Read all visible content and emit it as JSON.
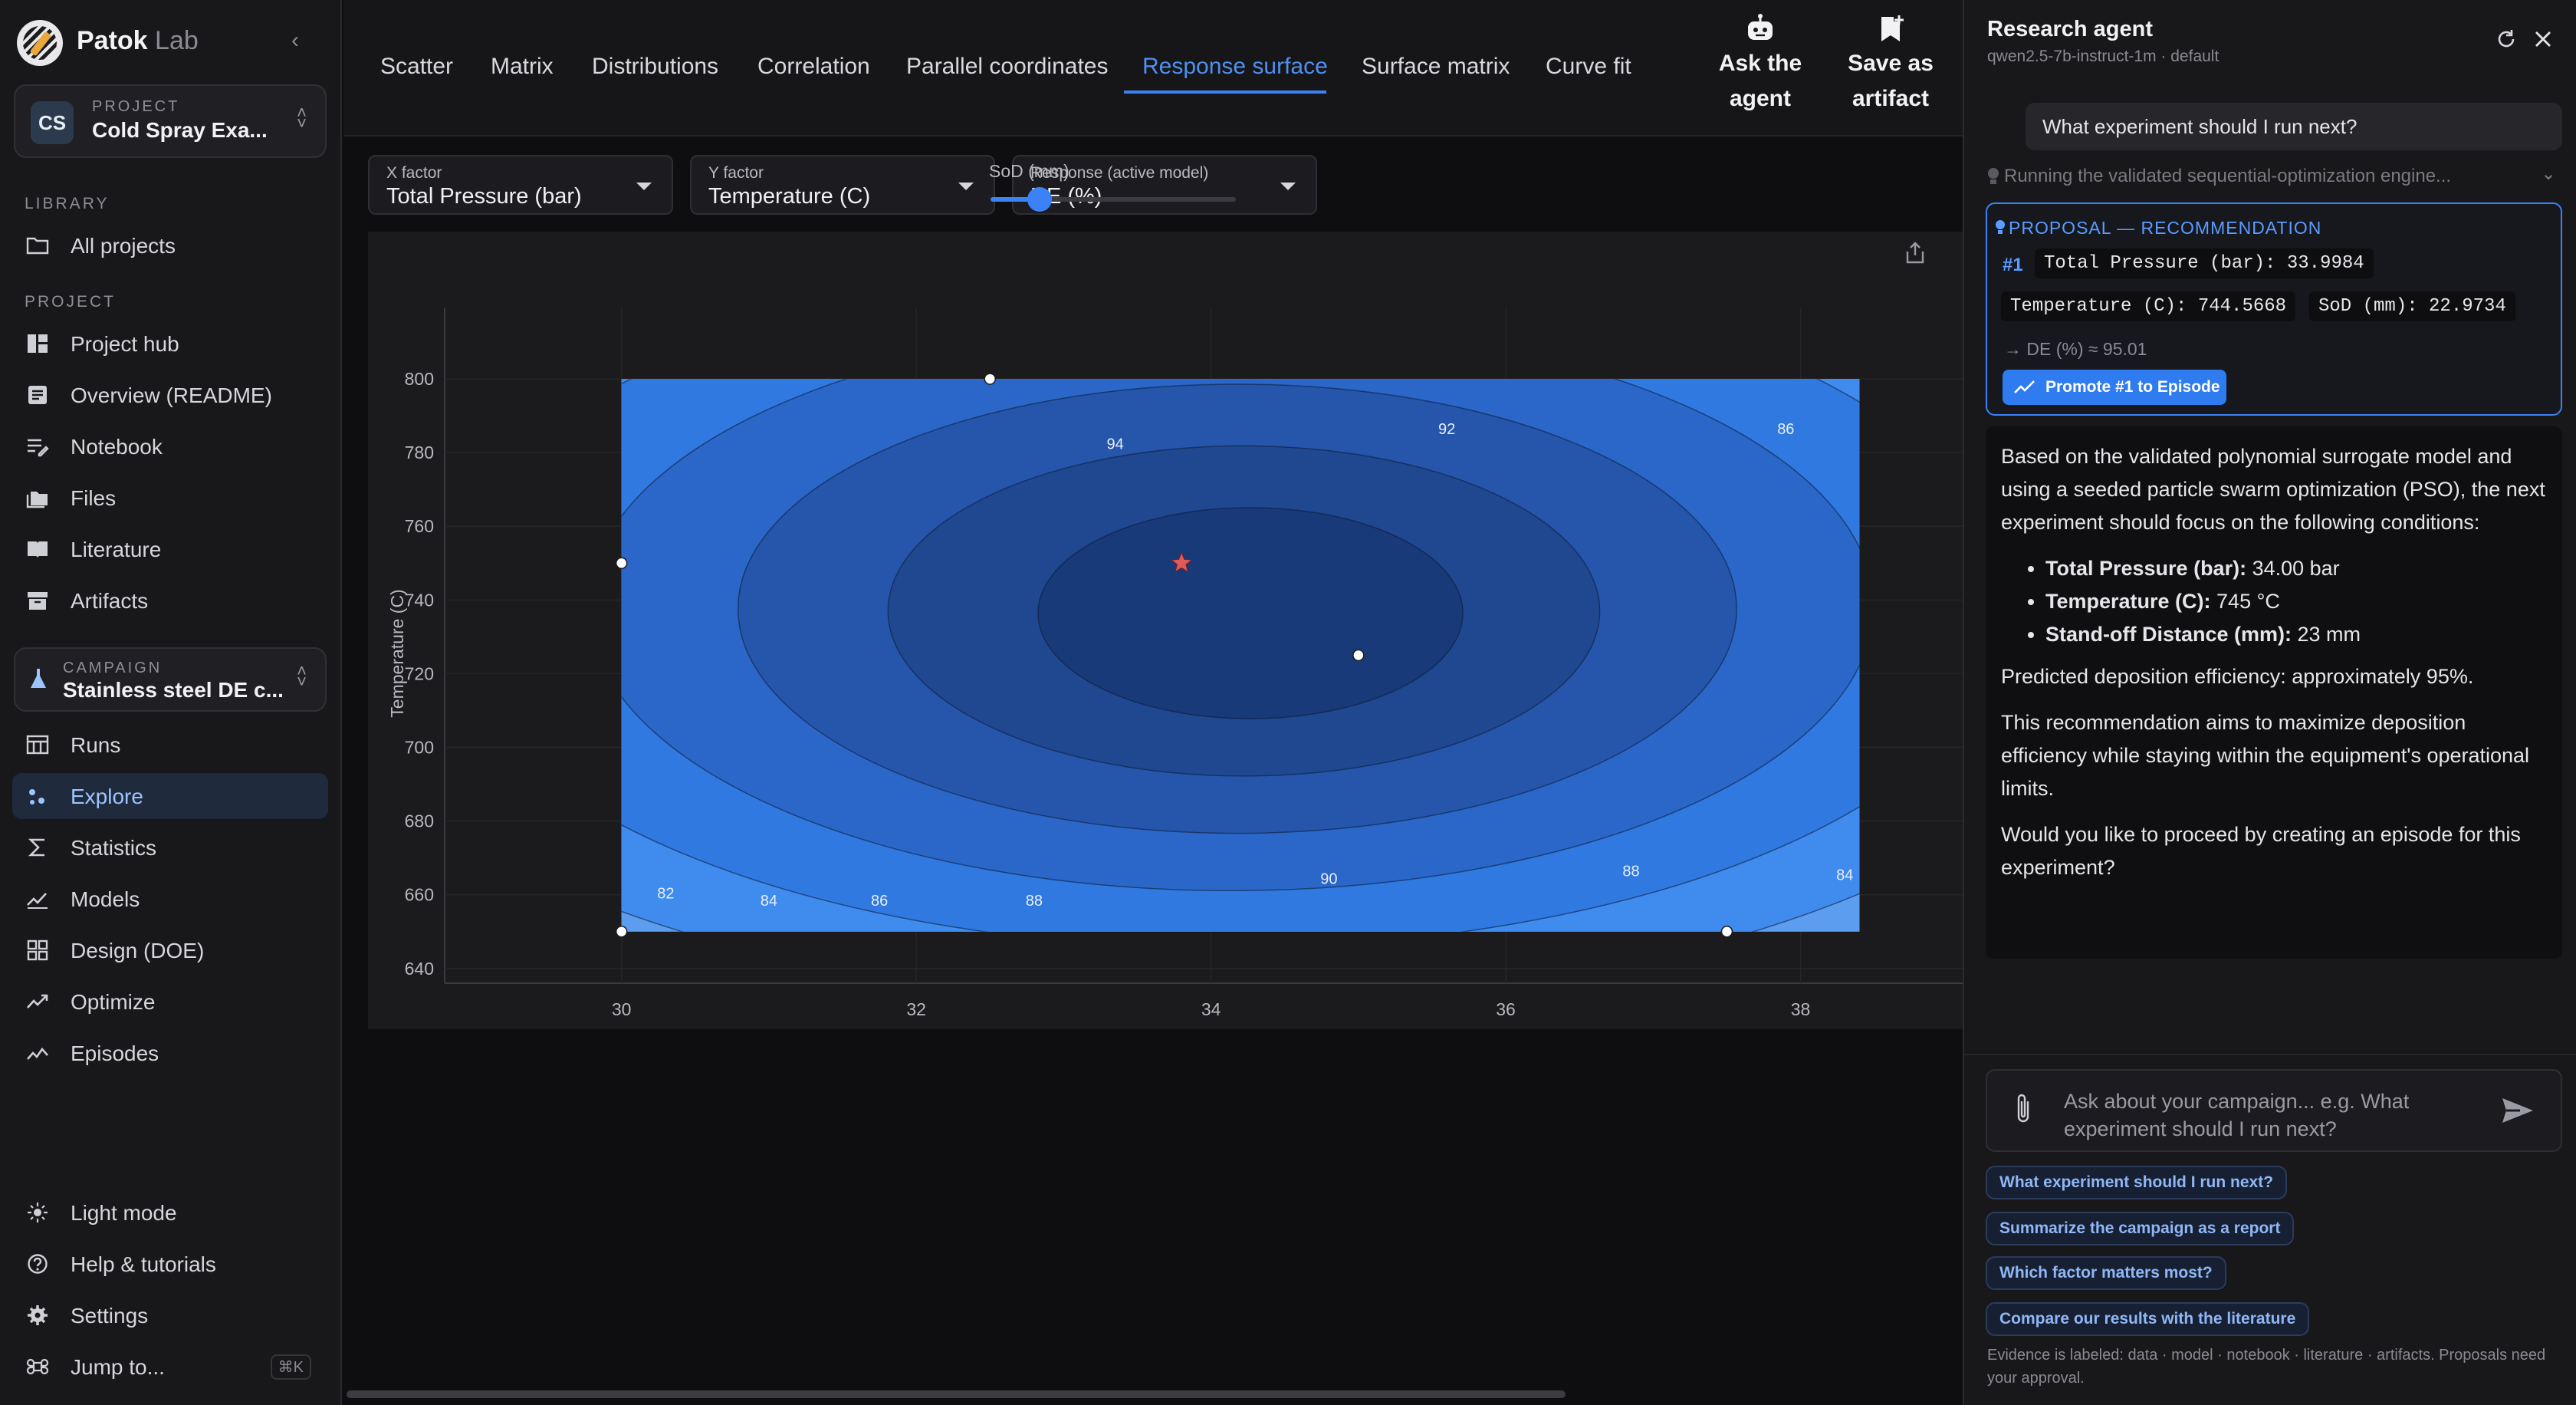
{
  "app": {
    "brand_bold": "Patok",
    "brand_light": "Lab"
  },
  "project": {
    "kicker": "PROJECT",
    "initials": "CS",
    "name": "Cold Spray Exa..."
  },
  "sidebar": {
    "library_label": "LIBRARY",
    "library_items": [
      {
        "label": "All projects",
        "icon": "folder-icon"
      }
    ],
    "project_label": "PROJECT",
    "project_items": [
      {
        "label": "Project hub",
        "icon": "dashboard-icon"
      },
      {
        "label": "Overview (README)",
        "icon": "document-icon"
      },
      {
        "label": "Notebook",
        "icon": "notebook-icon"
      },
      {
        "label": "Files",
        "icon": "files-icon"
      },
      {
        "label": "Literature",
        "icon": "book-icon"
      },
      {
        "label": "Artifacts",
        "icon": "archive-icon"
      }
    ],
    "campaign": {
      "kicker": "CAMPAIGN",
      "name": "Stainless steel DE c..."
    },
    "campaign_items": [
      {
        "label": "Runs",
        "icon": "table-icon"
      },
      {
        "label": "Explore",
        "icon": "scatter-icon",
        "active": true
      },
      {
        "label": "Statistics",
        "icon": "sigma-icon"
      },
      {
        "label": "Models",
        "icon": "trend-icon"
      },
      {
        "label": "Design (DOE)",
        "icon": "grid-icon"
      },
      {
        "label": "Optimize",
        "icon": "optimize-icon"
      },
      {
        "label": "Episodes",
        "icon": "episodes-icon"
      }
    ],
    "bottom_items": [
      {
        "label": "Light mode",
        "icon": "sun-icon"
      },
      {
        "label": "Help & tutorials",
        "icon": "help-icon"
      },
      {
        "label": "Settings",
        "icon": "gear-icon"
      },
      {
        "label": "Jump to...",
        "icon": "command-icon",
        "shortcut": "⌘K"
      }
    ]
  },
  "tabs": [
    "Scatter",
    "Matrix",
    "Distributions",
    "Correlation",
    "Parallel coordinates",
    "Response surface",
    "Surface matrix",
    "Curve fit"
  ],
  "active_tab": "Response surface",
  "actions": {
    "ask_line1": "Ask the",
    "ask_line2": "agent",
    "save_line1": "Save as",
    "save_line2": "artifact"
  },
  "controls": {
    "x_factor": {
      "caption": "X factor",
      "value": "Total Pressure (bar)"
    },
    "y_factor": {
      "caption": "Y factor",
      "value": "Temperature (C)"
    },
    "response": {
      "caption": "Response (active model)",
      "value": "DE (%)"
    },
    "slider": {
      "caption": "SoD (mm)",
      "level": 0.2
    }
  },
  "chart_data": {
    "type": "contour",
    "xlabel": "Total Pressure (bar)",
    "ylabel": "Temperature (C)",
    "xlim": [
      28.8,
      39.1
    ],
    "ylim": [
      636,
      815
    ],
    "x_ticks": [
      30,
      32,
      34,
      36,
      38
    ],
    "y_ticks": [
      640,
      660,
      680,
      700,
      720,
      740,
      760,
      780,
      800
    ],
    "plot_region": {
      "x": [
        30,
        38.4
      ],
      "y": [
        650,
        800
      ]
    },
    "contour_levels": [
      82,
      84,
      86,
      88,
      90,
      92,
      94
    ],
    "level_colors": [
      "#7fb0ec",
      "#5c9df0",
      "#3f8bee",
      "#2f79e0",
      "#2a67c8",
      "#2556ab",
      "#1f4891",
      "#183a78"
    ],
    "surface_center": {
      "x": 34,
      "y": 740
    },
    "contour_labels": [
      {
        "text": "94",
        "x": 33.35,
        "y": 781
      },
      {
        "text": "92",
        "x": 35.6,
        "y": 785
      },
      {
        "text": "86",
        "x": 37.9,
        "y": 785
      },
      {
        "text": "90",
        "x": 34.8,
        "y": 663
      },
      {
        "text": "88",
        "x": 36.85,
        "y": 665
      },
      {
        "text": "84",
        "x": 38.3,
        "y": 664
      },
      {
        "text": "82",
        "x": 30.3,
        "y": 659
      },
      {
        "text": "84",
        "x": 31.0,
        "y": 657
      },
      {
        "text": "86",
        "x": 31.75,
        "y": 657
      },
      {
        "text": "88",
        "x": 32.8,
        "y": 657
      }
    ],
    "observed_points": [
      {
        "x": 32.5,
        "y": 800
      },
      {
        "x": 30,
        "y": 750
      },
      {
        "x": 35,
        "y": 725
      },
      {
        "x": 30,
        "y": 650
      },
      {
        "x": 37.5,
        "y": 650
      }
    ],
    "optimum": {
      "x": 33.8,
      "y": 750
    }
  },
  "agent": {
    "title": "Research agent",
    "model": "qwen2.5-7b-instruct-1m · default",
    "user_message": "What experiment should I run next?",
    "status": "Running the validated sequential-optimization engine...",
    "proposal": {
      "header": "PROPOSAL — RECOMMENDATION",
      "rank": "#1",
      "chips": [
        "Total Pressure (bar): 33.9984",
        "Temperature (C): 744.5668",
        "SoD (mm): 22.9734"
      ],
      "predicted": "→ DE (%) ≈ 95.01",
      "promote_label": "Promote #1 to Episode"
    },
    "answer": {
      "intro": "Based on the validated polynomial surrogate model and using a seeded particle swarm optimization (PSO), the next experiment should focus on the following conditions:",
      "bullets": [
        {
          "label": "Total Pressure (bar):",
          "value": " 34.00 bar"
        },
        {
          "label": "Temperature (C):",
          "value": " 745 °C"
        },
        {
          "label": "Stand-off Distance (mm):",
          "value": " 23 mm"
        }
      ],
      "predicted": "Predicted deposition efficiency: approximately 95%.",
      "aim": "This recommendation aims to maximize deposition efficiency while staying within the equipment's operational limits.",
      "question": "Would you like to proceed by creating an episode for this experiment?"
    },
    "composer_placeholder": "Ask about your campaign... e.g. What experiment should I run next?",
    "suggestions": [
      "What experiment should I run next?",
      "Summarize the campaign as a report",
      "Which factor matters most?",
      "Compare our results with the literature"
    ],
    "footnote": "Evidence is labeled: data · model · notebook · literature · artifacts. Proposals need your approval."
  }
}
